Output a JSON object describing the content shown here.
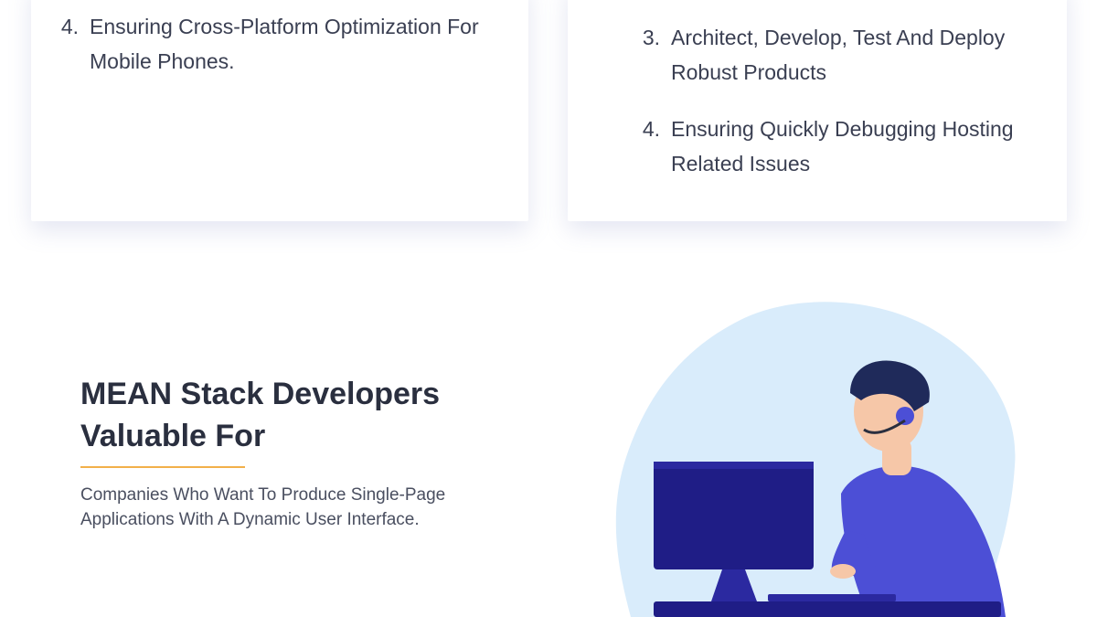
{
  "left_card": {
    "items": [
      {
        "number": "4.",
        "text": "Ensuring Cross-Platform Optimization For Mobile Phones."
      }
    ]
  },
  "right_card": {
    "items": [
      {
        "number": "3.",
        "text": "Architect, Develop, Test And Deploy Robust Products"
      },
      {
        "number": "4.",
        "text": "Ensuring Quickly Debugging Hosting Related Issues"
      }
    ]
  },
  "section": {
    "heading": "MEAN Stack Developers Valuable For",
    "description": "Companies Who Want To Produce Single-Page Applications With A Dynamic User Interface."
  },
  "colors": {
    "accent_underline": "#f2b04a",
    "blob": "#d9ecfb",
    "shirt": "#4c4fd6",
    "monitor": "#1f1d86"
  },
  "illustration": {
    "icon": "developer-at-computer-illustration"
  }
}
